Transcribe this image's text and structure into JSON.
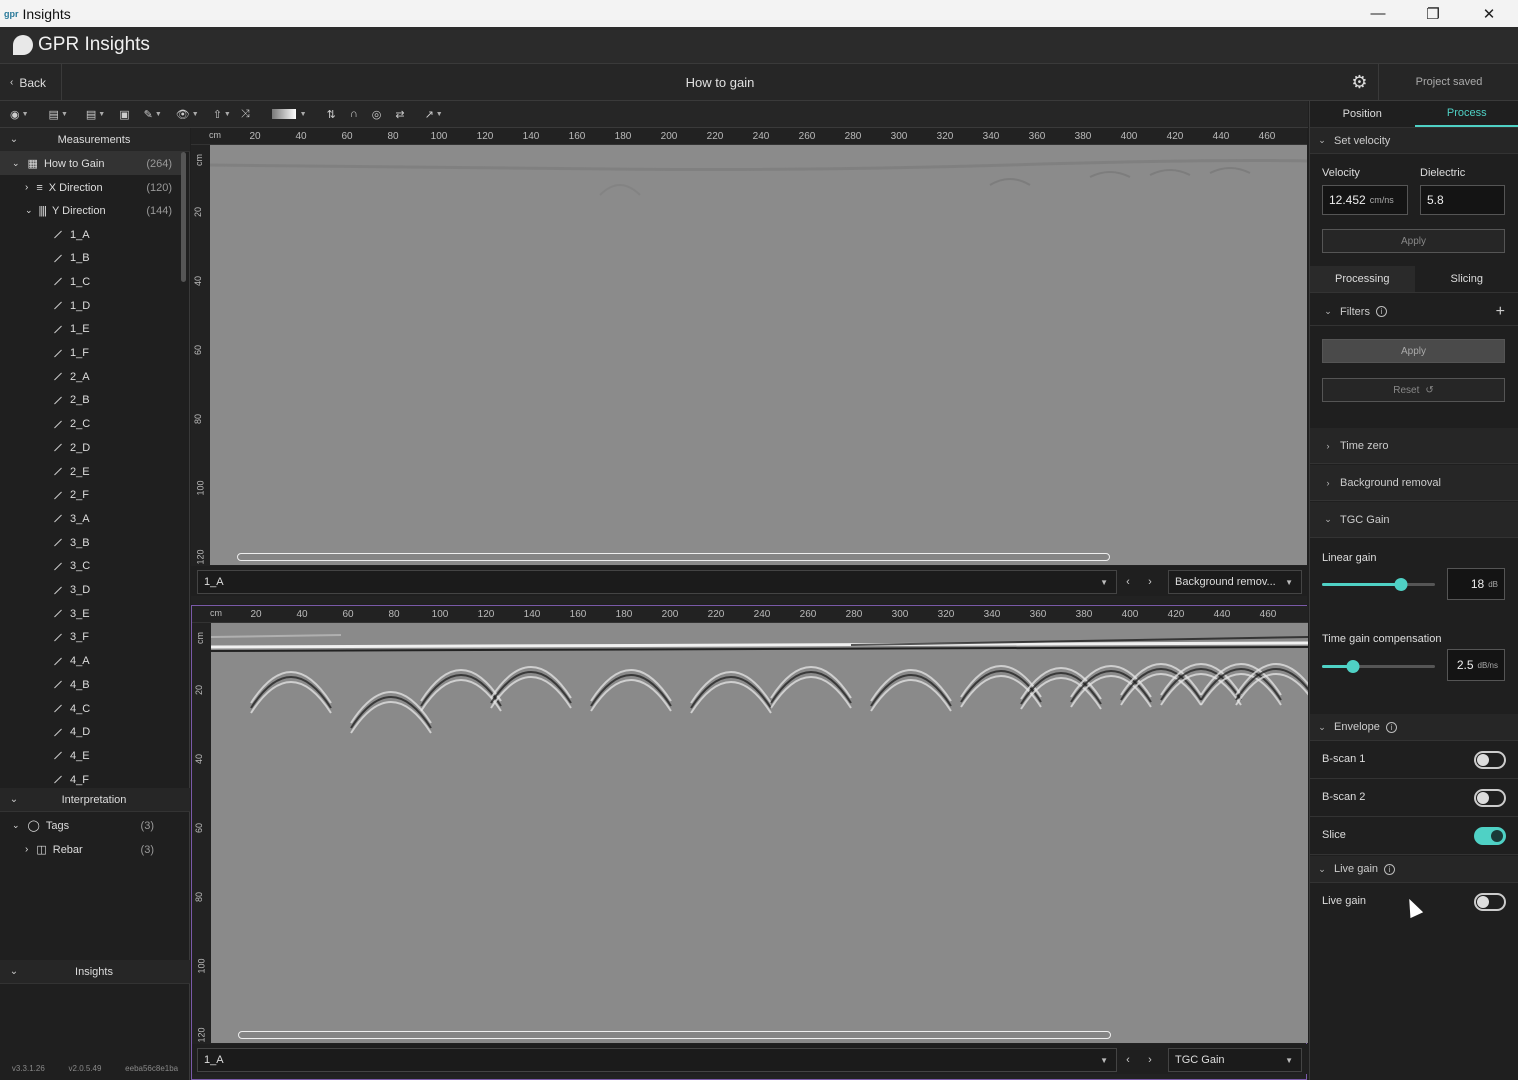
{
  "window": {
    "logo": "gpr",
    "title": "Insights"
  },
  "app": {
    "brand": "GPR Insights"
  },
  "header": {
    "back_label": "Back",
    "page_title": "How to gain",
    "status": "Project saved"
  },
  "measurements": {
    "section_label": "Measurements",
    "root": {
      "label": "How to Gain",
      "count": "(264)"
    },
    "x_direction": {
      "label": "X Direction",
      "count": "(120)"
    },
    "y_direction": {
      "label": "Y Direction",
      "count": "(144)"
    },
    "lines": [
      "1_A",
      "1_B",
      "1_C",
      "1_D",
      "1_E",
      "1_F",
      "2_A",
      "2_B",
      "2_C",
      "2_D",
      "2_E",
      "2_F",
      "3_A",
      "3_B",
      "3_C",
      "3_D",
      "3_E",
      "3_F",
      "4_A",
      "4_B",
      "4_C",
      "4_D",
      "4_E",
      "4_F"
    ]
  },
  "interpretation": {
    "section_label": "Interpretation",
    "tags": {
      "label": "Tags",
      "count": "(3)"
    },
    "rebar": {
      "label": "Rebar",
      "count": "(3)"
    }
  },
  "insights": {
    "section_label": "Insights"
  },
  "versions": [
    "v3.3.1.26",
    "v2.0.5.49",
    "eeba56c8e1ba"
  ],
  "ruler": {
    "unit": "cm",
    "ticks": [
      "20",
      "40",
      "60",
      "80",
      "100",
      "120",
      "140",
      "160",
      "180",
      "200",
      "220",
      "240",
      "260",
      "280",
      "300",
      "320",
      "340",
      "360",
      "380",
      "400",
      "420",
      "440",
      "460"
    ],
    "vunit": "cm",
    "vticks": [
      "20",
      "40",
      "60",
      "80",
      "100",
      "120"
    ]
  },
  "scan_top": {
    "line": "1_A",
    "process": "Background remov..."
  },
  "scan_bottom": {
    "line": "1_A",
    "process": "TGC Gain"
  },
  "right": {
    "tabs": [
      "Position",
      "Process"
    ],
    "set_velocity": {
      "label": "Set velocity",
      "velocity_label": "Velocity",
      "velocity_value": "12.452",
      "velocity_unit": "cm/ns",
      "dielectric_label": "Dielectric",
      "dielectric_value": "5.8",
      "apply": "Apply"
    },
    "subtabs": [
      "Processing",
      "Slicing"
    ],
    "filters": {
      "label": "Filters",
      "apply": "Apply",
      "reset": "Reset"
    },
    "time_zero": "Time zero",
    "background_removal": "Background removal",
    "tgc": {
      "label": "TGC Gain",
      "linear_label": "Linear gain",
      "linear_value": "18",
      "linear_unit": "dB",
      "linear_level": 0.7,
      "tgc_label": "Time gain compensation",
      "tgc_value": "2.5",
      "tgc_unit": "dB/ns",
      "tgc_level": 0.27
    },
    "envelope": {
      "label": "Envelope",
      "bscan1": "B-scan 1",
      "bscan2": "B-scan 2",
      "slice": "Slice"
    },
    "live_gain": {
      "section": "Live gain",
      "toggle": "Live gain"
    }
  },
  "colors": {
    "accent": "#4fd1c5"
  }
}
